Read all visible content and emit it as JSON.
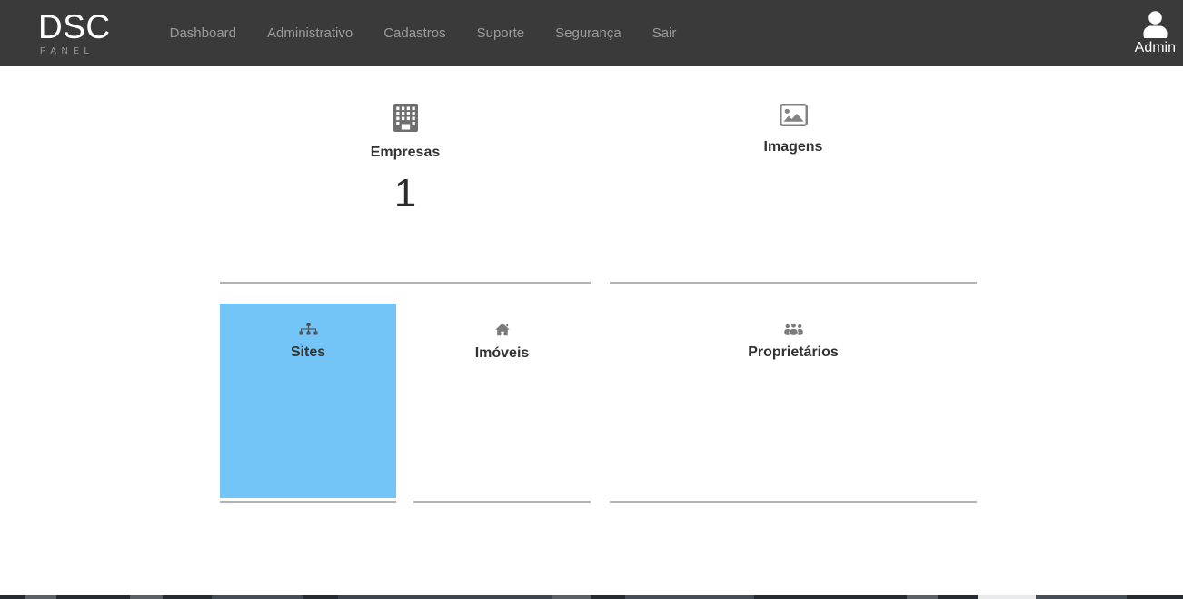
{
  "brand": {
    "name": "DSC",
    "subtitle": "PANEL"
  },
  "nav": {
    "items": [
      "Dashboard",
      "Administrativo",
      "Cadastros",
      "Suporte",
      "Segurança",
      "Sair"
    ]
  },
  "user": {
    "name": "Admin"
  },
  "dashboard": {
    "tiles": [
      {
        "id": "empresas",
        "label": "Empresas",
        "count": "1",
        "icon": "building-icon"
      },
      {
        "id": "imagens",
        "label": "Imagens",
        "icon": "image-icon"
      },
      {
        "id": "sites",
        "label": "Sites",
        "icon": "sitemap-icon",
        "highlighted": true
      },
      {
        "id": "imoveis",
        "label": "Imóveis",
        "icon": "home-icon"
      },
      {
        "id": "proprietarios",
        "label": "Proprietários",
        "icon": "users-icon"
      }
    ]
  },
  "colors": {
    "navbar_bg": "#3a3a3a",
    "nav_link": "#9b9b9b",
    "brand_text": "#ffffff",
    "brand_subtitle": "#9a9a9a",
    "tile_label": "#333333",
    "count_text": "#2b2b2b",
    "highlight_bg": "#74c5f7",
    "divider": "#b3b3b3"
  }
}
